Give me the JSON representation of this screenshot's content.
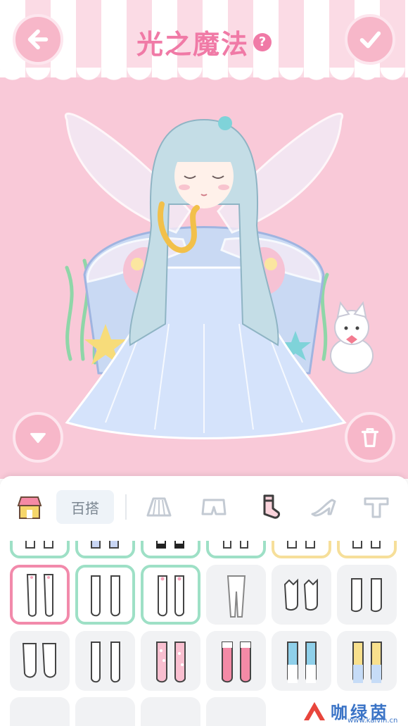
{
  "header": {
    "title": "光之魔法",
    "help_label": "?"
  },
  "toolbar": {
    "mix_label": "百搭",
    "tabs": [
      "shop-icon",
      "skirt-icon",
      "shorts-icon",
      "sock-icon",
      "high-heel-icon",
      "top-icon"
    ],
    "active_tab": "sock-icon"
  },
  "colors": {
    "accent": "#f07aa6",
    "button_pink": "#f7b7c9",
    "selected_border": "#f28aab",
    "owned_border": "#9ee0c6",
    "new_border": "#f6df9a"
  },
  "watermark": {
    "text": "咖绿茵",
    "url": "www.kalvin.cn"
  }
}
